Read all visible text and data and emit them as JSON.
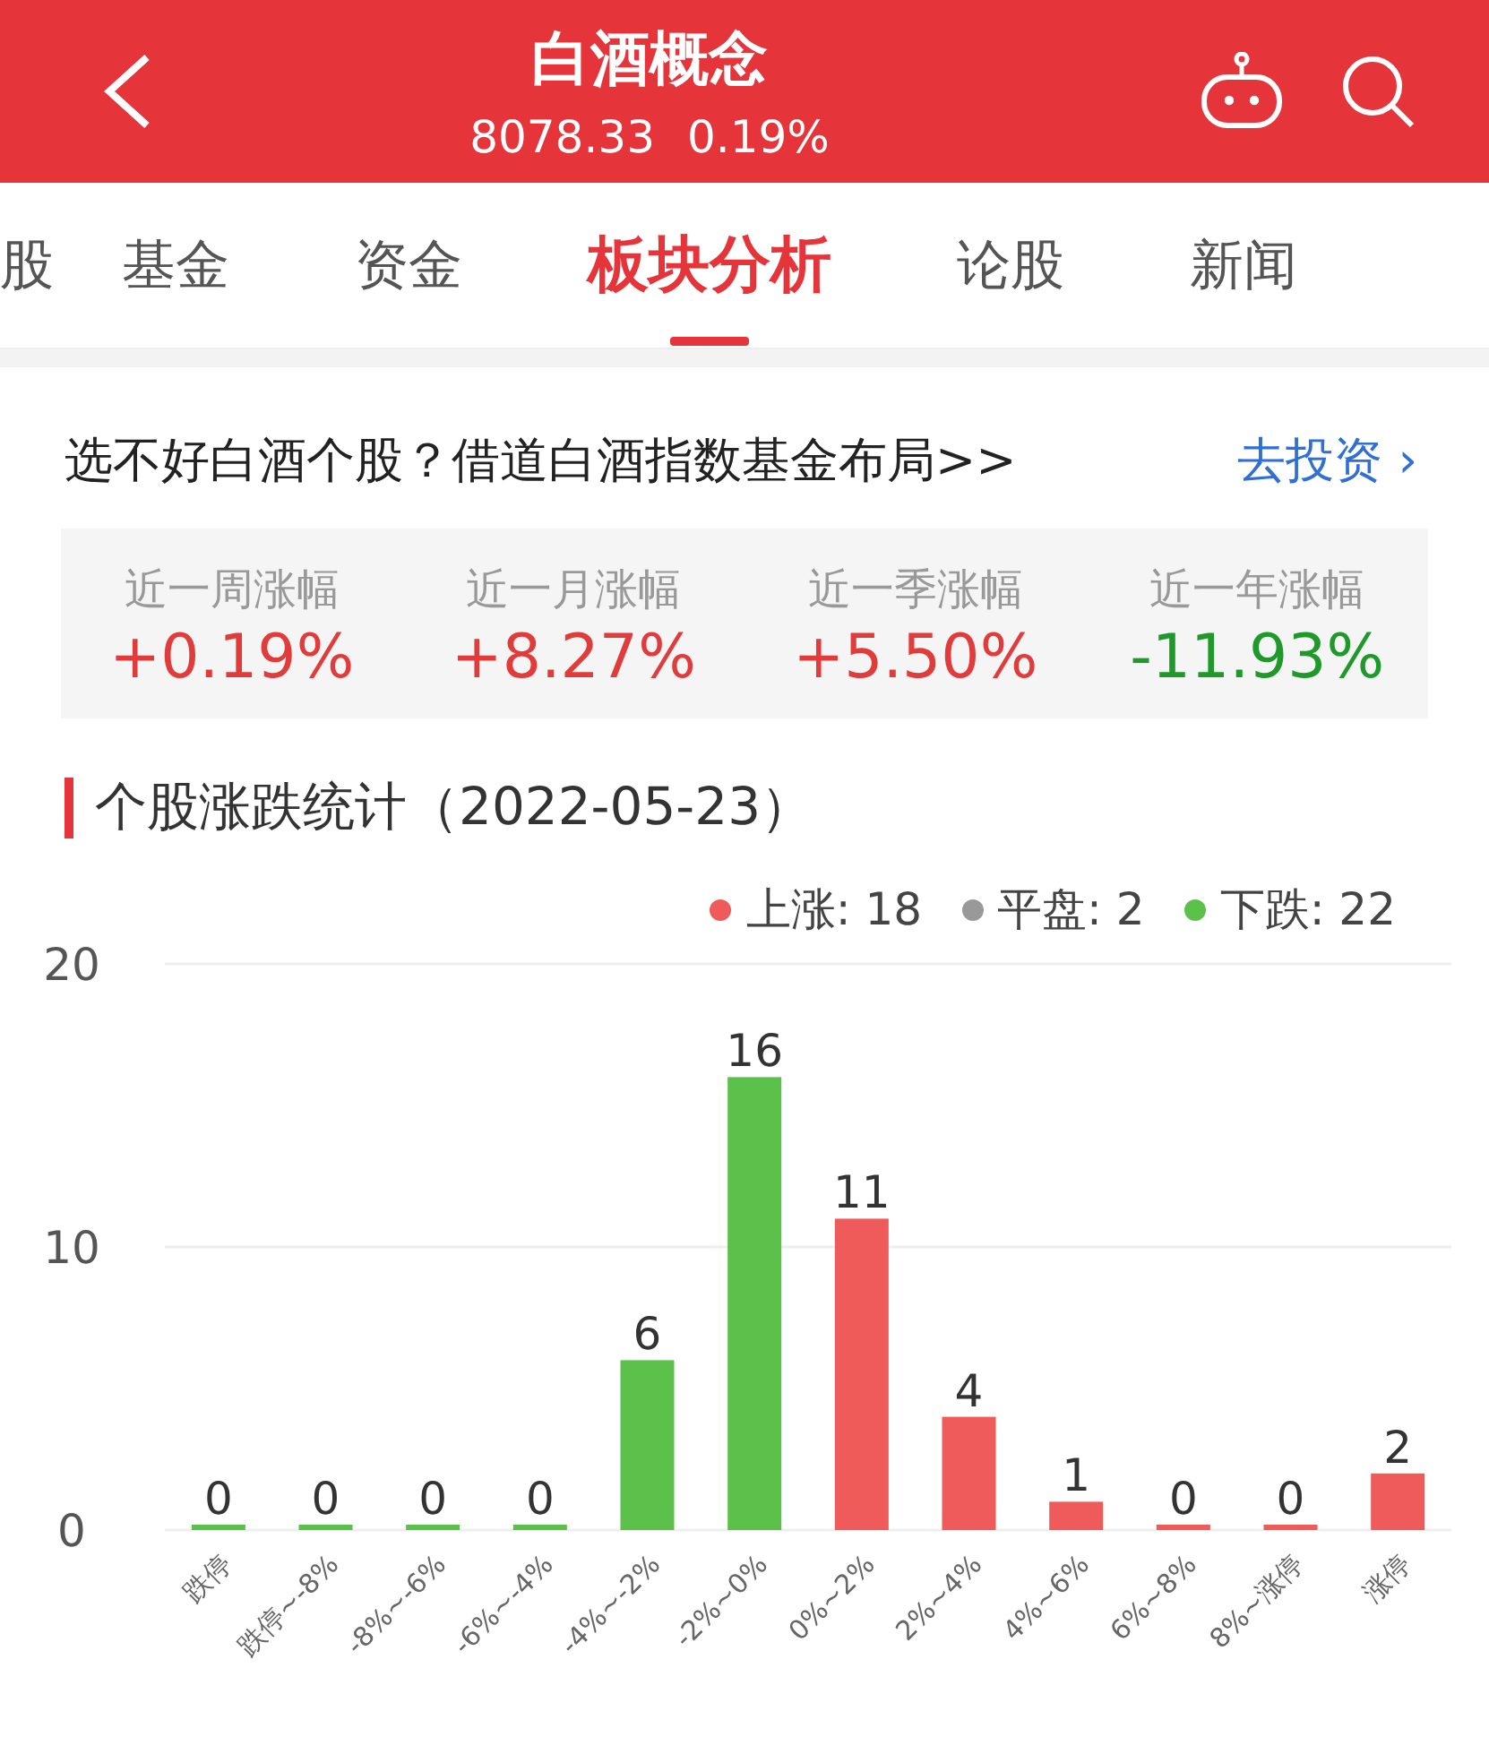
{
  "header": {
    "title": "白酒概念",
    "price": "8078.33",
    "change": "0.19%"
  },
  "tabs": [
    {
      "label": "股",
      "selected": false
    },
    {
      "label": "基金",
      "selected": false
    },
    {
      "label": "资金",
      "selected": false
    },
    {
      "label": "板块分析",
      "selected": true
    },
    {
      "label": "论股",
      "selected": false
    },
    {
      "label": "新闻",
      "selected": false
    }
  ],
  "promo": {
    "text": "选不好白酒个股？借道白酒指数基金布局>>",
    "link": "去投资 ›"
  },
  "returns": [
    {
      "label": "近一周涨幅",
      "value": "+0.19%",
      "color": "#e03c3c"
    },
    {
      "label": "近一月涨幅",
      "value": "+8.27%",
      "color": "#e03c3c"
    },
    {
      "label": "近一季涨幅",
      "value": "+5.50%",
      "color": "#e03c3c"
    },
    {
      "label": "近一年涨幅",
      "value": "-11.93%",
      "color": "#1f9a2a"
    }
  ],
  "section": {
    "title": "个股涨跌统计（2022-05-23）"
  },
  "legend": [
    {
      "label": "上涨: 18",
      "color": "#ef5b5b"
    },
    {
      "label": "平盘: 2",
      "color": "#999999"
    },
    {
      "label": "下跌: 22",
      "color": "#5cc14a"
    }
  ],
  "chart_data": {
    "type": "bar",
    "data_labels": true,
    "categories": [
      "跌停",
      "跌停~-8%",
      "-8%~-6%",
      "-6%~-4%",
      "-4%~-2%",
      "-2%~0%",
      "0%~2%",
      "2%~4%",
      "4%~6%",
      "6%~8%",
      "8%~涨停",
      "涨停"
    ],
    "series": [
      {
        "color": "#5cc14a",
        "values": [
          0,
          0,
          0,
          0,
          6,
          16,
          null,
          null,
          null,
          null,
          null,
          null
        ]
      },
      {
        "color": "#ef5b5b",
        "values": [
          null,
          null,
          null,
          null,
          null,
          null,
          11,
          4,
          1,
          0,
          0,
          2
        ]
      }
    ],
    "ylim": [
      0,
      20
    ],
    "yticks": [
      0,
      10,
      20
    ]
  }
}
